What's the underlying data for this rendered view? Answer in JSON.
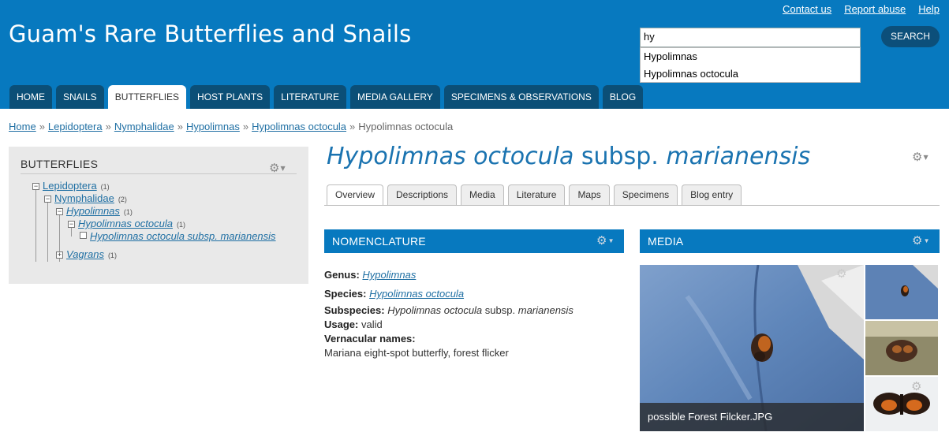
{
  "header": {
    "site_title": "Guam's Rare Butterflies and Snails",
    "links": [
      "Contact us",
      "Report abuse",
      "Help"
    ],
    "search_value": "hy",
    "search_button": "SEARCH",
    "autocomplete": [
      "Hypolimnas",
      "Hypolimnas octocula"
    ]
  },
  "nav": {
    "tabs": [
      "HOME",
      "SNAILS",
      "BUTTERFLIES",
      "HOST PLANTS",
      "LITERATURE",
      "MEDIA GALLERY",
      "SPECIMENS & OBSERVATIONS",
      "BLOG"
    ],
    "active": "BUTTERFLIES"
  },
  "breadcrumb": {
    "links": [
      "Home",
      "Lepidoptera",
      "Nymphalidae",
      "Hypolimnas",
      "Hypolimnas octocula"
    ],
    "current": "Hypolimnas octocula",
    "separator": "»"
  },
  "sidebar": {
    "title": "BUTTERFLIES",
    "tree": [
      {
        "label": "Lepidoptera",
        "count": "(1)"
      },
      {
        "label": "Nymphalidae",
        "count": "(2)"
      },
      {
        "label": "Hypolimnas",
        "count": "(1)"
      },
      {
        "label": "Hypolimnas octocula",
        "count": "(1)"
      },
      {
        "label": "Hypolimnas octocula subsp. marianensis",
        "count": ""
      },
      {
        "label": "Vagrans",
        "count": "(1)"
      }
    ]
  },
  "page": {
    "title_genus_species": "Hypolimnas octocula",
    "title_rank": "subsp.",
    "title_epithet": "marianensis",
    "tabs": [
      "Overview",
      "Descriptions",
      "Media",
      "Literature",
      "Maps",
      "Specimens",
      "Blog entry"
    ],
    "active_tab": "Overview"
  },
  "nomenclature": {
    "heading": "NOMENCLATURE",
    "genus_label": "Genus:",
    "genus_value": "Hypolimnas",
    "species_label": "Species:",
    "species_value": "Hypolimnas octocula",
    "subspecies_label": "Subspecies:",
    "subspecies_name": "Hypolimnas octocula",
    "subspecies_rank": "subsp.",
    "subspecies_epithet": "marianensis",
    "usage_label": "Usage:",
    "usage_value": "valid",
    "vernacular_label": "Vernacular names:",
    "vernacular_value": "Mariana eight-spot butterfly, forest flicker"
  },
  "media": {
    "heading": "MEDIA",
    "caption": "possible Forest Filcker.JPG"
  },
  "icons": {
    "gear": "gear-icon",
    "tree_minus": "collapse-icon",
    "tree_plus": "expand-icon"
  },
  "colors": {
    "brand_blue": "#0779bf",
    "nav_dark": "#0b4f77",
    "link": "#1f6fa3"
  }
}
